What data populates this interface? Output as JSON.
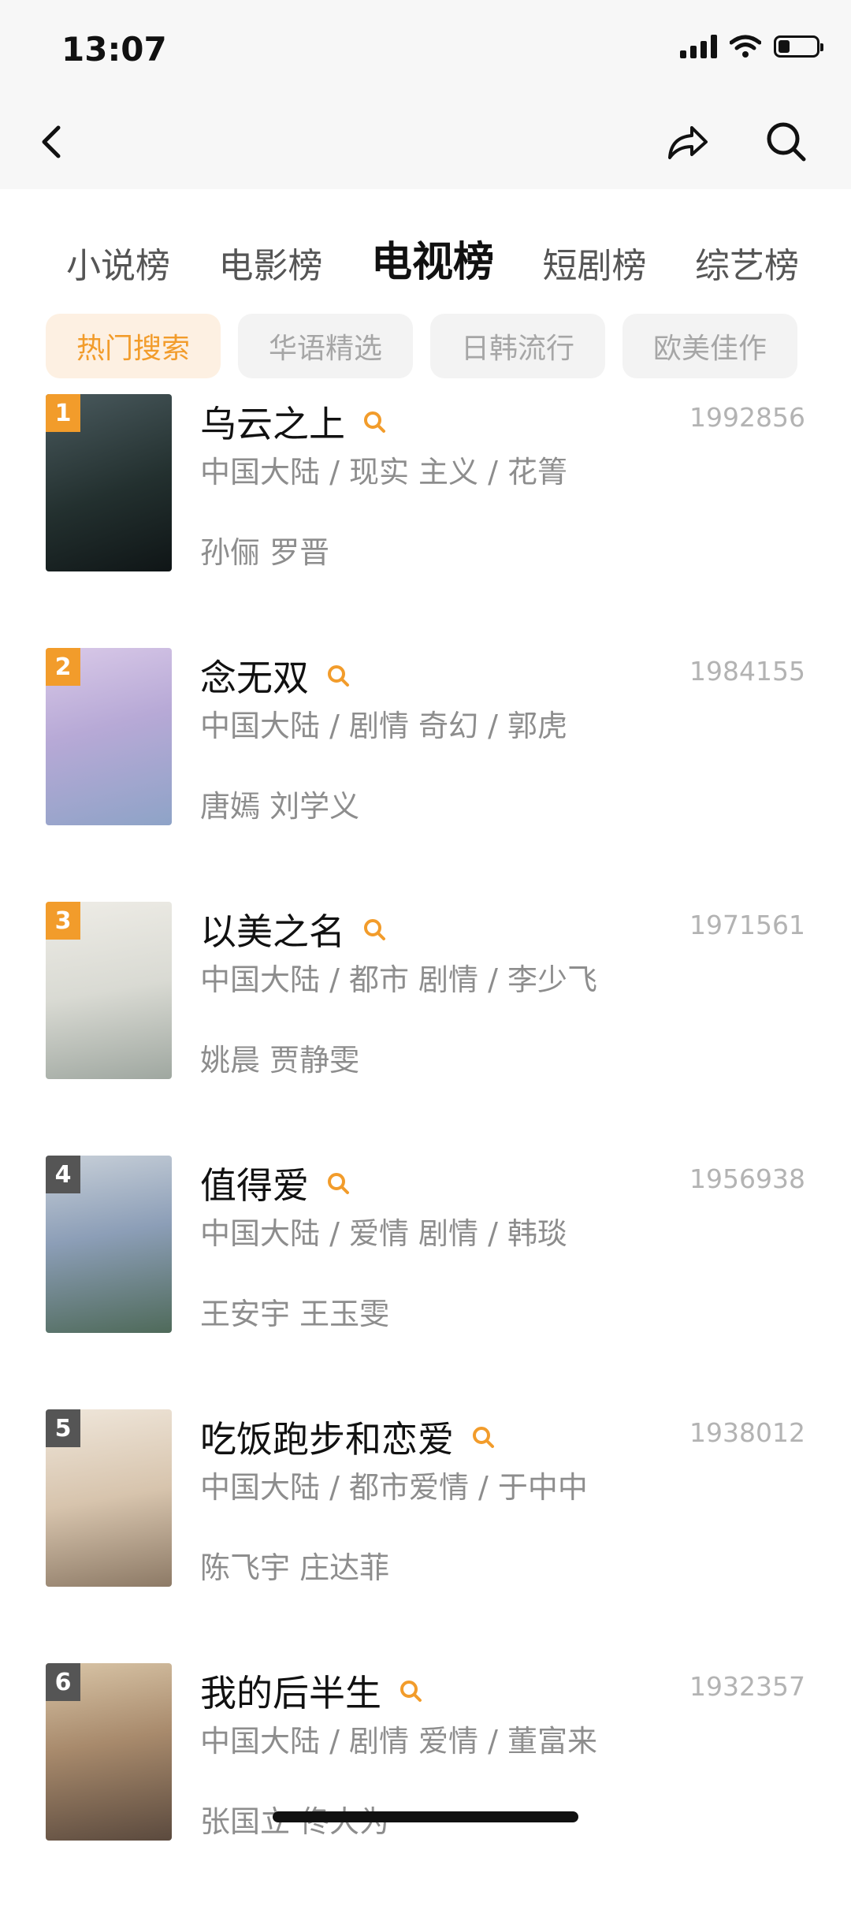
{
  "status_bar": {
    "time": "13:07",
    "battery_level": 0.3
  },
  "nav": {
    "back_icon": "chevron-left-icon",
    "share_icon": "share-arrow-icon",
    "search_icon": "search-icon"
  },
  "tabs": [
    {
      "label": "小说榜",
      "active": false
    },
    {
      "label": "电影榜",
      "active": false
    },
    {
      "label": "电视榜",
      "active": true
    },
    {
      "label": "短剧榜",
      "active": false
    },
    {
      "label": "综艺榜",
      "active": false
    }
  ],
  "chips": [
    {
      "label": "热门搜索",
      "active": true
    },
    {
      "label": "华语精选",
      "active": false
    },
    {
      "label": "日韩流行",
      "active": false
    },
    {
      "label": "欧美佳作",
      "active": false
    }
  ],
  "colors": {
    "accent": "#f29c2b",
    "chip_active_bg": "#fdf0e2",
    "rank_other": "#555555",
    "meta_text": "#8d8d8d"
  },
  "list": [
    {
      "rank": "1",
      "title": "乌云之上",
      "score": "1992856",
      "meta": "中国大陆 / 现实 主义 / 花箐",
      "cast": "孙俪 罗晋"
    },
    {
      "rank": "2",
      "title": "念无双",
      "score": "1984155",
      "meta": "中国大陆 / 剧情 奇幻 / 郭虎",
      "cast": "唐嫣 刘学义"
    },
    {
      "rank": "3",
      "title": "以美之名",
      "score": "1971561",
      "meta": "中国大陆 / 都市 剧情 / 李少飞",
      "cast": "姚晨 贾静雯"
    },
    {
      "rank": "4",
      "title": "值得爱",
      "score": "1956938",
      "meta": "中国大陆 / 爱情 剧情 / 韩琰",
      "cast": "王安宇 王玉雯"
    },
    {
      "rank": "5",
      "title": "吃饭跑步和恋爱",
      "score": "1938012",
      "meta": "中国大陆 / 都市爱情 / 于中中",
      "cast": "陈飞宇 庄达菲"
    },
    {
      "rank": "6",
      "title": "我的后半生",
      "score": "1932357",
      "meta": "中国大陆 / 剧情 爱情 / 董富来",
      "cast": "张国立 佟大为"
    }
  ]
}
